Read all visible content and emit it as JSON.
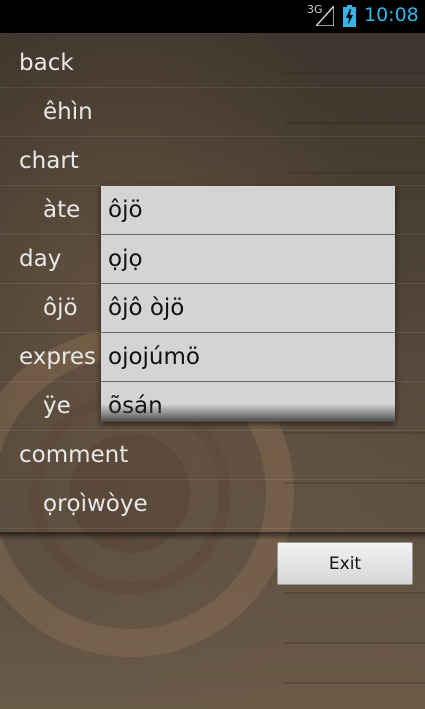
{
  "status_bar": {
    "network": "3G",
    "time": "10:08",
    "accent_color": "#33b5e5",
    "icons": [
      "signal-icon",
      "battery-charging-icon"
    ]
  },
  "list": {
    "rows": [
      {
        "kind": "word",
        "text": "back"
      },
      {
        "kind": "translation",
        "text": "êhìn"
      },
      {
        "kind": "word",
        "text": "chart"
      },
      {
        "kind": "translation",
        "text": "àte"
      },
      {
        "kind": "word",
        "text": "day"
      },
      {
        "kind": "translation",
        "text": "ôjö"
      },
      {
        "kind": "word",
        "text": "expres"
      },
      {
        "kind": "translation",
        "text": "ÿe"
      },
      {
        "kind": "word",
        "text": "comment"
      },
      {
        "kind": "translation",
        "text": "ọrọìwòye"
      }
    ]
  },
  "popup": {
    "options": [
      "ôjö",
      "ọjọ",
      "ôjô òjö",
      "ojojúmö",
      "õsán"
    ]
  },
  "exit_button": {
    "label": "Exit"
  }
}
